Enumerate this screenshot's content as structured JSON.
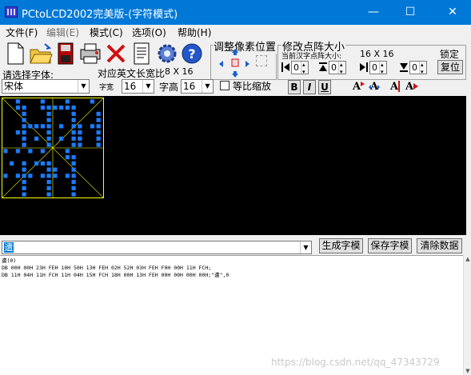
{
  "window": {
    "title": "PCtoLCD2002完美版-(字符模式)",
    "minimize_glyph": "—",
    "maximize_glyph": "☐",
    "close_glyph": "✕"
  },
  "menu": [
    {
      "label": "文件(F)"
    },
    {
      "label": "编辑(E)"
    },
    {
      "label": "模式(C)"
    },
    {
      "label": "选项(O)"
    },
    {
      "label": "帮助(H)"
    }
  ],
  "toolbar": {
    "buttons": [
      {
        "icon": "new-file-icon"
      },
      {
        "icon": "open-folder-icon"
      },
      {
        "icon": "save-icon"
      },
      {
        "icon": "print-icon"
      },
      {
        "icon": "delete-icon"
      },
      {
        "icon": "notes-icon"
      },
      {
        "icon": "settings-gear-icon"
      },
      {
        "icon": "help-icon"
      }
    ],
    "font_select_label": "请选择字体:",
    "font_value": "宋体",
    "en_width_label": "对应英文长宽比",
    "en_width_value": "8 X 16",
    "char_width_label": "字宽",
    "char_width_value": "16",
    "char_height_label": "字高",
    "char_height_value": "16",
    "proportional_label": "等比缩放",
    "bold_label": "B",
    "italic_label": "I",
    "underline_label": "U"
  },
  "pixel_adjust": {
    "title": "调整像素位置"
  },
  "dot_matrix": {
    "title": "修改点阵大小",
    "current_size_label": "当前汉字点阵大小:",
    "current_size_value": "16 X 16",
    "lock_label": "锁定",
    "reset_label": "复位",
    "spins": [
      "0",
      "0",
      "0",
      "0"
    ]
  },
  "canvas": {
    "pixel_color": "#1a7cff",
    "grid_color": "#ffff00"
  },
  "input": {
    "value": "遭"
  },
  "actions": {
    "generate_label": "生成字模",
    "save_label": "保存字模",
    "clear_label": "清除数据"
  },
  "output": {
    "lines": [
      "遭(0)",
      "",
      "DB 00H 00H 23H FEH 10H 50H 13H FEH 02H 52H 03H FEH F0H 00H 11H FCH;",
      "DB 11H 04H 11H FCH 11H 04H 15H FCH 18H 00H 13H FEH 00H 00H 00H 00H;\"遭\",0"
    ]
  },
  "watermark": "https://blog.csdn.net/qq_47343729"
}
